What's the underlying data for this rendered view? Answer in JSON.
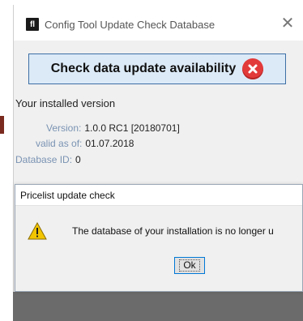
{
  "main_window": {
    "title": "Config Tool Update Check Database",
    "icon_letter": "fl",
    "close_glyph": "✕",
    "header": "Check data update availability",
    "section_heading": "Your installed version",
    "fields": [
      {
        "label": "Version:",
        "value": "1.0.0 RC1 [20180701]"
      },
      {
        "label": "valid as of:",
        "value": "01.07.2018"
      },
      {
        "label": "Database ID:",
        "value": "0"
      }
    ]
  },
  "dialog": {
    "title": "Pricelist update check",
    "message": "The database of your installation is no longer u",
    "ok_label": "Ok",
    "icon": "warning-icon"
  },
  "colors": {
    "header_bg": "#dceaf7",
    "header_border": "#3d6fa5",
    "error_red": "#e23a3a",
    "label_blue": "#7a93b3",
    "warning_yellow": "#f2c500"
  }
}
